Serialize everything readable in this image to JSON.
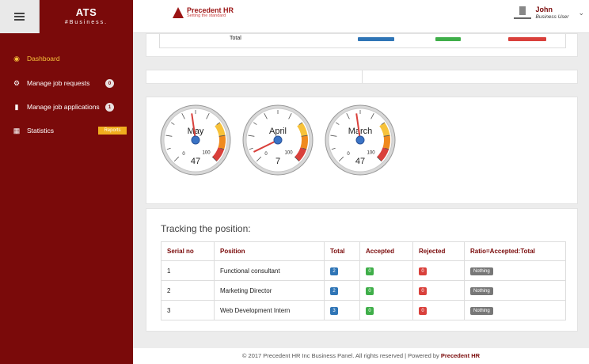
{
  "brand": {
    "title": "ATS",
    "subtitle": "#Business."
  },
  "logo": {
    "name": "Precedent HR",
    "tagline": "Setting the standard"
  },
  "user": {
    "name": "John",
    "role": "Business User"
  },
  "sidebar": {
    "items": [
      {
        "label": "Dashboard",
        "icon": "dashboard-icon"
      },
      {
        "label": "Manage job requests",
        "badge": "0",
        "icon": "gears-icon"
      },
      {
        "label": "Manage job applications",
        "badge": "1",
        "icon": "book-icon"
      },
      {
        "label": "Statistics",
        "badge": "Reports",
        "icon": "bar-chart-icon"
      }
    ]
  },
  "top_table": {
    "total_label": "Total"
  },
  "gauges": [
    {
      "month": "May",
      "value": 47,
      "max_label": "100",
      "min_label": "0"
    },
    {
      "month": "April",
      "value": 7,
      "max_label": "100",
      "min_label": "0"
    },
    {
      "month": "March",
      "value": 47,
      "max_label": "100",
      "min_label": "0"
    }
  ],
  "tracking": {
    "title": "Tracking the position:",
    "headers": [
      "Serial no",
      "Position",
      "Total",
      "Accepted",
      "Rejected",
      "Ratio=Accepted:Total"
    ],
    "rows": [
      {
        "serial": "1",
        "position": "Functional consultant",
        "total": "2",
        "accepted": "0",
        "rejected": "0",
        "ratio": "Nothing"
      },
      {
        "serial": "2",
        "position": "Marketing Director",
        "total": "2",
        "accepted": "0",
        "rejected": "0",
        "ratio": "Nothing"
      },
      {
        "serial": "3",
        "position": "Web Development Intern",
        "total": "3",
        "accepted": "0",
        "rejected": "0",
        "ratio": "Nothing"
      }
    ]
  },
  "footer": {
    "text": "© 2017 Precedent HR Inc Business Panel. All rights reserved | Powered by",
    "link": "Precedent HR"
  }
}
